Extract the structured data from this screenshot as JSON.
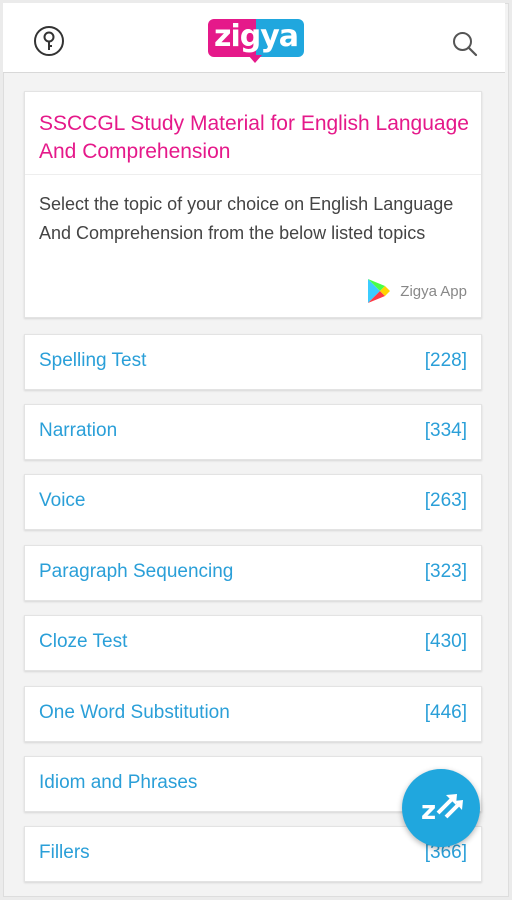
{
  "header": {
    "logo_text": "zigya",
    "left_icon": "info-key-icon",
    "right_icon": "search-icon",
    "brand_pink": "#e5198a",
    "brand_blue": "#20a7de"
  },
  "intro": {
    "title": "SSCCGL Study Material for English Language And Comprehension",
    "description": "Select the topic of your choice on English Language And Comprehension from the below listed topics",
    "app_label": "Zigya App"
  },
  "topics": [
    {
      "name": "Spelling Test",
      "count": "[228]"
    },
    {
      "name": "Narration",
      "count": "[334]"
    },
    {
      "name": "Voice",
      "count": "[263]"
    },
    {
      "name": "Paragraph Sequencing",
      "count": "[323]"
    },
    {
      "name": "Cloze Test",
      "count": "[430]"
    },
    {
      "name": "One Word Substitution",
      "count": "[446]"
    },
    {
      "name": "Idiom and Phrases",
      "count": ""
    },
    {
      "name": "Fillers",
      "count": "[366]"
    }
  ],
  "fab": {
    "icon": "zigya-share-icon"
  }
}
